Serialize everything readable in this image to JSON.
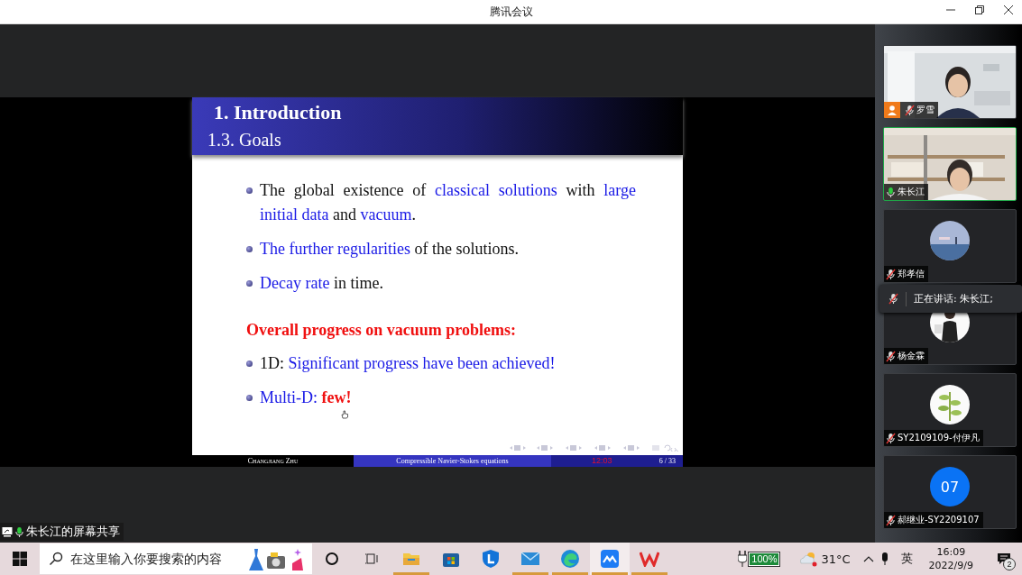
{
  "window": {
    "title": "腾讯会议"
  },
  "slide": {
    "title": "1. Introduction",
    "subtitle": "1.3. Goals",
    "blocks": [
      {
        "kind": "bullet",
        "segments": [
          {
            "text": "The global existence of ",
            "kind": "plain"
          },
          {
            "text": "classical solutions",
            "kind": "emphasis"
          },
          {
            "text": " with ",
            "kind": "plain"
          },
          {
            "text": "large initial data",
            "kind": "emphasis"
          },
          {
            "text": " and ",
            "kind": "plain"
          },
          {
            "text": "vacuum",
            "kind": "emphasis"
          },
          {
            "text": ".",
            "kind": "plain"
          }
        ]
      },
      {
        "kind": "bullet",
        "segments": [
          {
            "text": "The further regularities",
            "kind": "emphasis"
          },
          {
            "text": " of the solutions.",
            "kind": "plain"
          }
        ]
      },
      {
        "kind": "bullet",
        "segments": [
          {
            "text": "Decay rate",
            "kind": "emphasis"
          },
          {
            "text": " in time.",
            "kind": "plain"
          }
        ]
      },
      {
        "kind": "heading",
        "segments": [
          {
            "text": "Overall progress on vacuum problems:",
            "kind": "alert"
          }
        ]
      },
      {
        "kind": "bullet",
        "segments": [
          {
            "text": "1D: ",
            "kind": "plain"
          },
          {
            "text": "Significant progress have been achieved!",
            "kind": "emphasis"
          }
        ]
      },
      {
        "kind": "bullet",
        "segments": [
          {
            "text": "Multi-D: ",
            "kind": "emphasis"
          },
          {
            "text": "few!",
            "kind": "alert"
          }
        ]
      }
    ],
    "footer": {
      "author": "Changjiang Zhu",
      "talk": "Compressible Navier-Stokes equations",
      "clock": "12:03",
      "page": "6 / 33"
    }
  },
  "screen_share_label": "朱长江的屏幕共享",
  "participants": [
    {
      "name": "罗雪",
      "kind": "video",
      "muted": true,
      "speaking": false,
      "host": true
    },
    {
      "name": "朱长江",
      "kind": "video",
      "muted": false,
      "speaking": true,
      "host": false
    },
    {
      "name": "郑孝信",
      "kind": "picture",
      "muted": true,
      "speaking": false,
      "host": false
    },
    {
      "name": "杨金霖",
      "kind": "picture",
      "muted": true,
      "speaking": false,
      "host": false
    },
    {
      "name": "SY2109109-付伊凡",
      "kind": "picture",
      "muted": true,
      "speaking": false,
      "host": false
    },
    {
      "name": "郝继业-SY2209107",
      "kind": "number",
      "avatar_text": "07",
      "muted": true,
      "speaking": false,
      "host": false
    }
  ],
  "speaking_tooltip": "正在讲话: 朱长江;",
  "taskbar": {
    "search": {
      "placeholder": "在这里输入你要搜索的内容"
    },
    "apps": [
      {
        "kind": "explorer",
        "running": true,
        "selected": false
      },
      {
        "kind": "store",
        "running": false,
        "selected": false
      },
      {
        "kind": "shield",
        "running": false,
        "selected": false
      },
      {
        "kind": "mail",
        "running": true,
        "selected": false
      },
      {
        "kind": "edge",
        "running": true,
        "selected": false
      },
      {
        "kind": "meeting",
        "running": true,
        "selected": true
      },
      {
        "kind": "wps",
        "running": true,
        "selected": false
      }
    ],
    "battery": "100%",
    "temperature": "31°C",
    "input_method": "英",
    "time": "16:09",
    "date": "2022/9/9",
    "notifications": "2"
  }
}
